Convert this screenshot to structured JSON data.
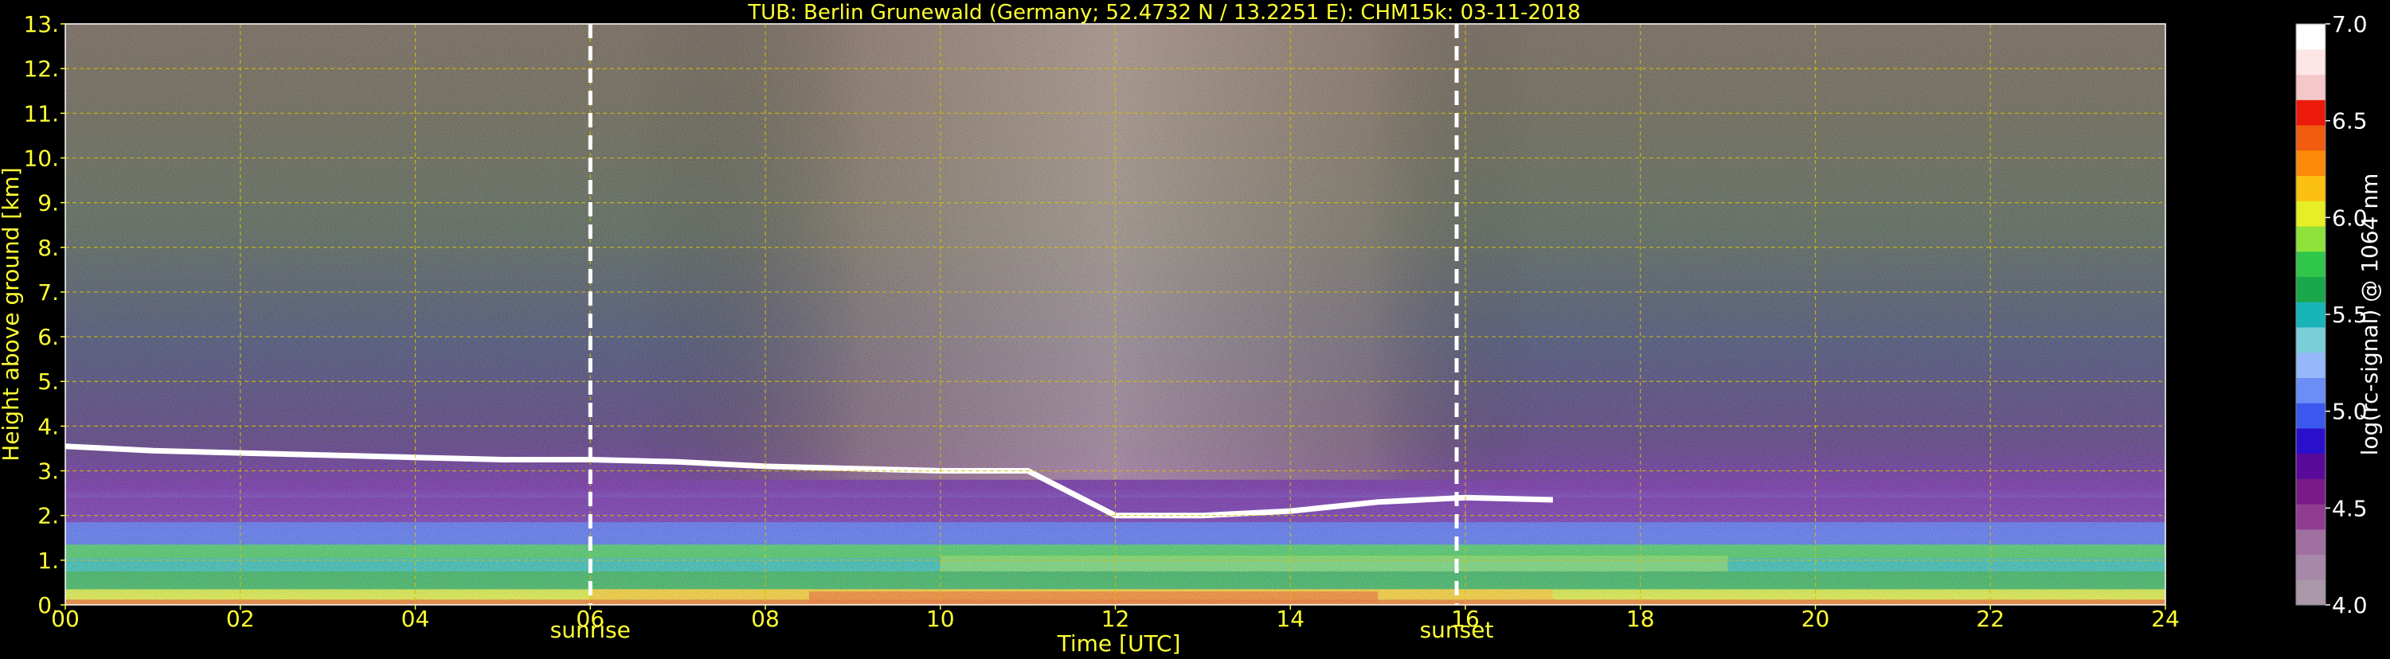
{
  "chart_data": {
    "type": "heatmap",
    "title": "TUB: Berlin Grunewald (Germany; 52.4732 N / 13.2251 E):    CHM15k: 03-11-2018",
    "xlabel": "Time [UTC]",
    "ylabel": "Height above ground [km]",
    "xlim": [
      0,
      24
    ],
    "ylim": [
      0,
      13
    ],
    "xticks": [
      "00",
      "02",
      "04",
      "06",
      "08",
      "10",
      "12",
      "14",
      "16",
      "18",
      "20",
      "22",
      "24"
    ],
    "yticks": [
      "0.",
      "1.",
      "2.",
      "3.",
      "4.",
      "5.",
      "6.",
      "7.",
      "8.",
      "9.",
      "10.",
      "11.",
      "12.",
      "13."
    ],
    "grid": true,
    "grid_color": "#d4c000",
    "text_color": "#ffff33",
    "annotations": [
      {
        "label": "sunrise",
        "x": 6.0
      },
      {
        "label": "sunset",
        "x": 15.9
      }
    ],
    "layers": [
      {
        "name": "cloud_layer",
        "points": [
          [
            0,
            3.55
          ],
          [
            1,
            3.45
          ],
          [
            2,
            3.4
          ],
          [
            3,
            3.35
          ],
          [
            4,
            3.3
          ],
          [
            5,
            3.25
          ],
          [
            6,
            3.25
          ],
          [
            7,
            3.2
          ],
          [
            8,
            3.1
          ],
          [
            9,
            3.05
          ],
          [
            10,
            3.0
          ],
          [
            11,
            3.0
          ],
          [
            12,
            2.0
          ],
          [
            13,
            2.0
          ],
          [
            14,
            2.1
          ],
          [
            15,
            2.3
          ],
          [
            16,
            2.4
          ],
          [
            17,
            2.35
          ]
        ]
      }
    ],
    "colorbar": {
      "label": "log(rc-signal) @ 1064 nm",
      "range": [
        4.0,
        7.0
      ],
      "ticks": [
        "4.0",
        "4.5",
        "5.0",
        "5.5",
        "6.0",
        "6.5",
        "7.0"
      ],
      "colors": [
        "#a898a8",
        "#a888a8",
        "#a070a0",
        "#903c90",
        "#7a1a88",
        "#5a0a9a",
        "#2a10cc",
        "#3a58ee",
        "#6a8ef6",
        "#96b8fa",
        "#7ad0d8",
        "#18b4b8",
        "#1aa64a",
        "#2fc64a",
        "#8fe23a",
        "#e8ee26",
        "#fcc010",
        "#fc8a08",
        "#f25c10",
        "#ec1a0a",
        "#f4c8c8",
        "#ffe6e6",
        "#ffffff"
      ]
    }
  }
}
